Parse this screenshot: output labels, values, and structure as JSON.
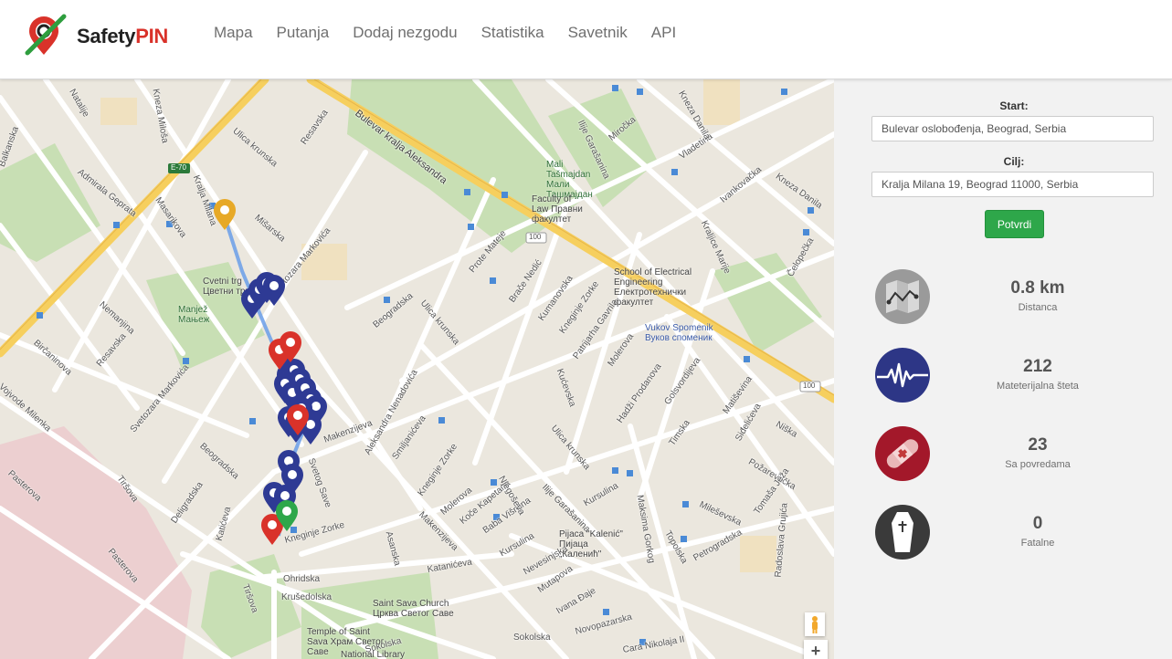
{
  "brand": {
    "name_part1": "Safety",
    "name_part2": "PIN"
  },
  "nav": {
    "items": [
      {
        "label": "Mapa"
      },
      {
        "label": "Putanja"
      },
      {
        "label": "Dodaj nezgodu"
      },
      {
        "label": "Statistika"
      },
      {
        "label": "Savetnik"
      },
      {
        "label": "API"
      }
    ]
  },
  "form": {
    "start_label": "Start:",
    "start_value": "Bulevar oslobođenja, Beograd, Serbia",
    "goal_label": "Cilj:",
    "goal_value": "Kralja Milana 19, Beograd 11000, Serbia",
    "submit_label": "Potvrdi"
  },
  "stats": [
    {
      "icon": "route-map-icon",
      "value": "0.8 km",
      "label": "Distanca",
      "color": "#9a9a9a"
    },
    {
      "icon": "pulse-icon",
      "value": "212",
      "label": "Mateterijalna šteta",
      "color": "#2d3686"
    },
    {
      "icon": "bandage-icon",
      "value": "23",
      "label": "Sa povredama",
      "color": "#a3182a"
    },
    {
      "icon": "coffin-icon",
      "value": "0",
      "label": "Fatalne",
      "color": "#3a3a3a"
    }
  ],
  "map": {
    "streets": [
      "Natalije",
      "Balkanska",
      "Admirala Geprata",
      "Masarikova",
      "Kralja Milana",
      "Ulica krunska",
      "Resavska",
      "Bulevar kralja Aleksandra",
      "Mišarska",
      "Svetozara Markovića",
      "Nemanjina",
      "Birčaninova",
      "Resavska",
      "Beogradska",
      "Prote Mateje",
      "Ulica krunska",
      "Kneza Miloša",
      "Ilije Garašanina",
      "Miročka",
      "Vladetina",
      "Kneza Danila",
      "Ivankovačka",
      "Kneza Danila",
      "Kraljice Marije",
      "Čelopečka",
      "Brače Nedić",
      "Kumanovska",
      "Kneginje Zorke",
      "Patrijarha Gavrila",
      "Molerova",
      "Kućevska",
      "Hadži Prodanova",
      "Golsvordijeva",
      "Ulica krunska",
      "Timska",
      "Matiševina",
      "Siđelićeva",
      "Niška",
      "Požarevačka",
      "Tomaša Ježa",
      "Mileševska",
      "Maksima Gorkog",
      "Topolska",
      "Petrogradska",
      "Radoslava Grujića",
      "Cara Nikolaja II",
      "Novopazarska",
      "Ivana Đaje",
      "Mutapova",
      "Nevesinjska",
      "Kursulina",
      "Kursulina",
      "Baba Višnjina",
      "Koče Kapetana",
      "Molerova",
      "Njegoševa",
      "Smiljanićeva",
      "Aleksandra Nenadovića",
      "Kneginje Zorke",
      "Makenzijeva",
      "Svetog Save",
      "Kneginje Zorke",
      "Katanićeva",
      "Ohridska",
      "Krušedolska",
      "Sokolska",
      "Katićeva",
      "Tiršova",
      "Deligradska",
      "Svetozara Markovića",
      "Vojvode Milenka",
      "Pasterova",
      "Tiršova",
      "Pasterova",
      "Makenzijeva",
      "Asanska",
      "Beogradska",
      "Ilije Garašanina",
      "Sokolska"
    ],
    "pois": [
      {
        "label": "Mali Tašmajdan Мали Ташмајдан",
        "kind": "park"
      },
      {
        "label": "Faculty of Law Правни факултет",
        "kind": "place"
      },
      {
        "label": "School of Electrical Engineering Електротехнички факултет",
        "kind": "place"
      },
      {
        "label": "Vukov Spomenik Вуков споменик",
        "kind": "transit"
      },
      {
        "label": "Cvetni trg Цветни трг",
        "kind": "place"
      },
      {
        "label": "Manjež Мањеж",
        "kind": "park"
      },
      {
        "label": "Pijaca \"Kalenić\" Пијаца „Каленић\"",
        "kind": "place"
      },
      {
        "label": "Saint Sava Church Црква Светог Саве",
        "kind": "place"
      },
      {
        "label": "Temple of Saint Sava Храм Светог Саве",
        "kind": "place"
      },
      {
        "label": "National Library",
        "kind": "place"
      }
    ],
    "road_shields": [
      "E-70",
      "100",
      "100",
      "100"
    ]
  }
}
